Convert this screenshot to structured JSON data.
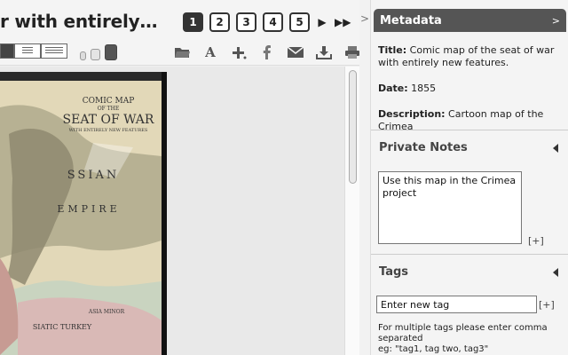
{
  "document": {
    "title": "r with entirely…"
  },
  "pager": {
    "pages": [
      "1",
      "2",
      "3",
      "4",
      "5"
    ],
    "active_page": "1",
    "next": "▶",
    "last": "▶▶"
  },
  "toolbar": {
    "tools": [
      {
        "icon": "folder-icon",
        "glyph": "📂"
      },
      {
        "icon": "font-icon",
        "glyph": "A"
      },
      {
        "icon": "add-icon",
        "glyph": "+."
      },
      {
        "icon": "facebook-icon",
        "glyph": "f"
      },
      {
        "icon": "email-icon",
        "glyph": "✉"
      },
      {
        "icon": "download-icon",
        "glyph": "⤓"
      },
      {
        "icon": "print-icon",
        "glyph": "⎙"
      }
    ]
  },
  "map": {
    "title_line1": "COMIC MAP",
    "title_line2": "OF THE",
    "title_line3": "SEAT OF WAR",
    "title_line4": "WITH ENTIRELY NEW FEATURES",
    "label_russian": "SSIAN",
    "label_empire": "EMPIRE",
    "label_turkey": "SIATIC TURKEY",
    "label_minor": "ASIA MINOR"
  },
  "panel": {
    "collapse_glyph": ">",
    "metadata_title": "Metadata",
    "metadata_collapse": ">",
    "fields": {
      "title_label": "Title:",
      "title_value": "Comic map of the seat of war with entirely new features.",
      "date_label": "Date:",
      "date_value": "1855",
      "description_label": "Description:",
      "description_value": "Cartoon map of the Crimea"
    },
    "private_notes": {
      "title": "Private Notes",
      "text": "Use this map in the Crimea project",
      "add": "[+]"
    },
    "tags": {
      "title": "Tags",
      "input_value": "Enter new tag",
      "add": "[+]",
      "help_line1": "For multiple tags please enter comma separated",
      "help_line2": "eg: \"tag1, tag two, tag3\""
    }
  },
  "colors": {
    "metadata_header": "#555555",
    "map_paper": "#e0d6b4",
    "map_dark": "#111111"
  }
}
